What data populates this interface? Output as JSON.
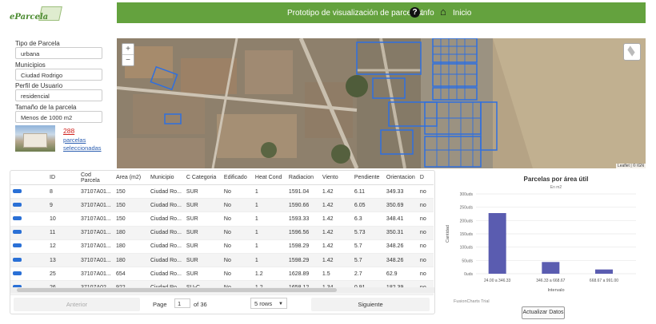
{
  "header": {
    "logo_text": "eParcela",
    "title": "Prototipo de visualización de parcelas.",
    "info_label": "Info",
    "home_label": "Inicio"
  },
  "sidebar": {
    "fields": [
      {
        "label": "Tipo de Parcela",
        "value": "urbana"
      },
      {
        "label": "Municipios",
        "value": "Ciudad Rodrigo"
      },
      {
        "label": "Perfil de Usuario",
        "value": "residencial"
      },
      {
        "label": "Tamaño de la parcela",
        "value": "Menos de 1000 m2"
      }
    ],
    "count": "288",
    "count_label": "parcelas seleccionadas"
  },
  "map": {
    "zoom_in": "+",
    "zoom_out": "−",
    "attribution": "Leaflet | © IGN"
  },
  "table": {
    "columns": [
      "",
      "ID",
      "Cod Parcela",
      "Area (m2)",
      "Municipio",
      "C Categoria",
      "Edificado",
      "Heat Cond",
      "Radiacion",
      "Viento",
      "Pendiente",
      "Orientacion",
      "D"
    ],
    "rows": [
      [
        "8",
        "37107A01...",
        "150",
        "Ciudad Ro...",
        "SUR",
        "No",
        "1",
        "1591.04",
        "1.42",
        "6.11",
        "349.33",
        "no"
      ],
      [
        "9",
        "37107A01...",
        "150",
        "Ciudad Ro...",
        "SUR",
        "No",
        "1",
        "1590.66",
        "1.42",
        "6.05",
        "350.69",
        "no"
      ],
      [
        "10",
        "37107A01...",
        "150",
        "Ciudad Ro...",
        "SUR",
        "No",
        "1",
        "1593.33",
        "1.42",
        "6.3",
        "348.41",
        "no"
      ],
      [
        "11",
        "37107A01...",
        "180",
        "Ciudad Ro...",
        "SUR",
        "No",
        "1",
        "1596.56",
        "1.42",
        "5.73",
        "350.31",
        "no"
      ],
      [
        "12",
        "37107A01...",
        "180",
        "Ciudad Ro...",
        "SUR",
        "No",
        "1",
        "1598.29",
        "1.42",
        "5.7",
        "348.26",
        "no"
      ],
      [
        "13",
        "37107A01...",
        "180",
        "Ciudad Ro...",
        "SUR",
        "No",
        "1",
        "1598.29",
        "1.42",
        "5.7",
        "348.26",
        "no"
      ],
      [
        "25",
        "37107A01...",
        "654",
        "Ciudad Ro...",
        "SUR",
        "No",
        "1.2",
        "1628.89",
        "1.5",
        "2.7",
        "62.9",
        "no"
      ],
      [
        "26",
        "37107A02...",
        "922",
        "Ciudad Ro...",
        "SU-C",
        "No",
        "1.2",
        "1658.12",
        "1.34",
        "0.91",
        "182.39",
        "no"
      ]
    ],
    "prev_label": "Anterior",
    "next_label": "Siguiente",
    "page_label": "Page",
    "page_value": "1",
    "page_total": "of 36",
    "rows_option": "5 rows"
  },
  "chart_data": {
    "type": "bar",
    "title": "Parcelas por área útil",
    "subtitle": "En m2",
    "xlabel": "Intervalo",
    "ylabel": "Cantidad",
    "categories": [
      "24.00 a 346.33",
      "346.33 a 668.67",
      "668.67 a 991.00"
    ],
    "values": [
      228,
      44,
      16
    ],
    "ylim": [
      0,
      300
    ],
    "yticks": [
      "0uds",
      "50uds",
      "100uds",
      "150uds",
      "200uds",
      "250uds",
      "300uds"
    ],
    "ytick_values": [
      0,
      50,
      100,
      150,
      200,
      250,
      300
    ],
    "bar_color": "#5a5cb0",
    "grid": true,
    "watermark": "FusionCharts Trial"
  },
  "update_button": "Actualizar Datos",
  "colors": {
    "accent": "#64a23e",
    "selection": "#2a70d6",
    "bar": "#5a5cb0",
    "parcel": "#2e6fe0"
  }
}
